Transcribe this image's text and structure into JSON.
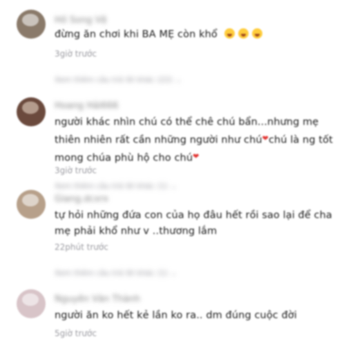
{
  "comments": [
    {
      "username": "Hồ Song Vệ",
      "text": "đừng ăn chơi khi BA MẸ còn khổ",
      "emoji": [
        "loudly-crying-face-icon",
        "loudly-crying-face-icon",
        "loudly-crying-face-icon"
      ],
      "time": "3giờ trước",
      "replies": "Xem thêm câu trả lời khác (22)",
      "avatar_color": "#8a7a6a"
    },
    {
      "username": "Hoang Hải666",
      "text_part1": "người khác nhìn chú có thể chê chú bẩn...nhưng mẹ thiên nhiên rất cần những người như chú",
      "text_part2": "chú là ng tốt mong chúa phù hộ cho chú",
      "time": "3giờ trước",
      "replies": "Xem thêm câu trả lời khác (1)",
      "avatar_color": "#6b4a3d"
    },
    {
      "username": "Giang.dcxrx",
      "text": "tự hỏi những đứa con của họ đâu hết rồi sao lại để cha mẹ phải khổ như v ..thương lắm",
      "time": "22phút trước",
      "replies": "Xem thêm câu trả lời khác (1)",
      "avatar_color": "#b7a08a"
    },
    {
      "username": "Nguyễn Văn Thành",
      "text": "người ăn ko hết kẻ lần ko ra.. dm đúng cuộc đời",
      "time": "5giờ trước",
      "avatar_color": "#d8c4c8"
    }
  ]
}
